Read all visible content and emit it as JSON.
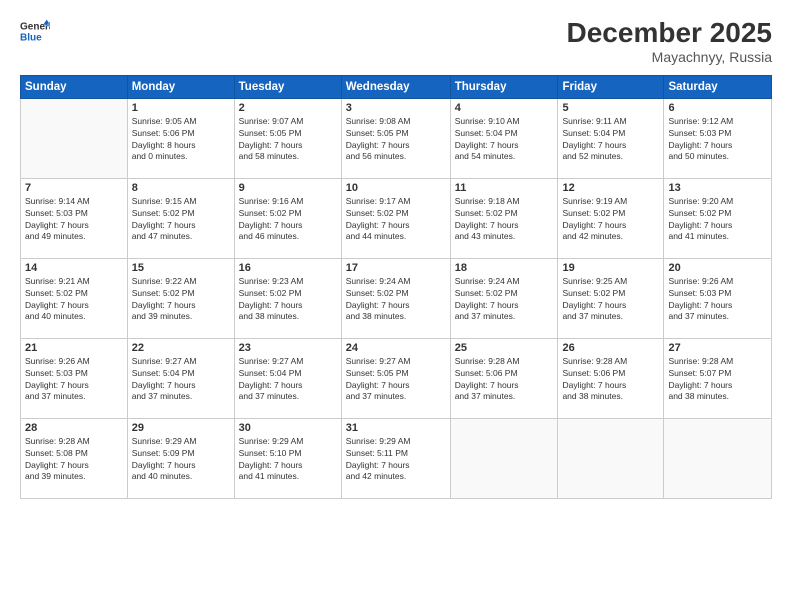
{
  "header": {
    "logo_line1": "General",
    "logo_line2": "Blue",
    "month": "December 2025",
    "location": "Mayachnyy, Russia"
  },
  "weekdays": [
    "Sunday",
    "Monday",
    "Tuesday",
    "Wednesday",
    "Thursday",
    "Friday",
    "Saturday"
  ],
  "weeks": [
    [
      {
        "day": "",
        "info": ""
      },
      {
        "day": "1",
        "info": "Sunrise: 9:05 AM\nSunset: 5:06 PM\nDaylight: 8 hours\nand 0 minutes."
      },
      {
        "day": "2",
        "info": "Sunrise: 9:07 AM\nSunset: 5:05 PM\nDaylight: 7 hours\nand 58 minutes."
      },
      {
        "day": "3",
        "info": "Sunrise: 9:08 AM\nSunset: 5:05 PM\nDaylight: 7 hours\nand 56 minutes."
      },
      {
        "day": "4",
        "info": "Sunrise: 9:10 AM\nSunset: 5:04 PM\nDaylight: 7 hours\nand 54 minutes."
      },
      {
        "day": "5",
        "info": "Sunrise: 9:11 AM\nSunset: 5:04 PM\nDaylight: 7 hours\nand 52 minutes."
      },
      {
        "day": "6",
        "info": "Sunrise: 9:12 AM\nSunset: 5:03 PM\nDaylight: 7 hours\nand 50 minutes."
      }
    ],
    [
      {
        "day": "7",
        "info": "Sunrise: 9:14 AM\nSunset: 5:03 PM\nDaylight: 7 hours\nand 49 minutes."
      },
      {
        "day": "8",
        "info": "Sunrise: 9:15 AM\nSunset: 5:02 PM\nDaylight: 7 hours\nand 47 minutes."
      },
      {
        "day": "9",
        "info": "Sunrise: 9:16 AM\nSunset: 5:02 PM\nDaylight: 7 hours\nand 46 minutes."
      },
      {
        "day": "10",
        "info": "Sunrise: 9:17 AM\nSunset: 5:02 PM\nDaylight: 7 hours\nand 44 minutes."
      },
      {
        "day": "11",
        "info": "Sunrise: 9:18 AM\nSunset: 5:02 PM\nDaylight: 7 hours\nand 43 minutes."
      },
      {
        "day": "12",
        "info": "Sunrise: 9:19 AM\nSunset: 5:02 PM\nDaylight: 7 hours\nand 42 minutes."
      },
      {
        "day": "13",
        "info": "Sunrise: 9:20 AM\nSunset: 5:02 PM\nDaylight: 7 hours\nand 41 minutes."
      }
    ],
    [
      {
        "day": "14",
        "info": "Sunrise: 9:21 AM\nSunset: 5:02 PM\nDaylight: 7 hours\nand 40 minutes."
      },
      {
        "day": "15",
        "info": "Sunrise: 9:22 AM\nSunset: 5:02 PM\nDaylight: 7 hours\nand 39 minutes."
      },
      {
        "day": "16",
        "info": "Sunrise: 9:23 AM\nSunset: 5:02 PM\nDaylight: 7 hours\nand 38 minutes."
      },
      {
        "day": "17",
        "info": "Sunrise: 9:24 AM\nSunset: 5:02 PM\nDaylight: 7 hours\nand 38 minutes."
      },
      {
        "day": "18",
        "info": "Sunrise: 9:24 AM\nSunset: 5:02 PM\nDaylight: 7 hours\nand 37 minutes."
      },
      {
        "day": "19",
        "info": "Sunrise: 9:25 AM\nSunset: 5:02 PM\nDaylight: 7 hours\nand 37 minutes."
      },
      {
        "day": "20",
        "info": "Sunrise: 9:26 AM\nSunset: 5:03 PM\nDaylight: 7 hours\nand 37 minutes."
      }
    ],
    [
      {
        "day": "21",
        "info": "Sunrise: 9:26 AM\nSunset: 5:03 PM\nDaylight: 7 hours\nand 37 minutes."
      },
      {
        "day": "22",
        "info": "Sunrise: 9:27 AM\nSunset: 5:04 PM\nDaylight: 7 hours\nand 37 minutes."
      },
      {
        "day": "23",
        "info": "Sunrise: 9:27 AM\nSunset: 5:04 PM\nDaylight: 7 hours\nand 37 minutes."
      },
      {
        "day": "24",
        "info": "Sunrise: 9:27 AM\nSunset: 5:05 PM\nDaylight: 7 hours\nand 37 minutes."
      },
      {
        "day": "25",
        "info": "Sunrise: 9:28 AM\nSunset: 5:06 PM\nDaylight: 7 hours\nand 37 minutes."
      },
      {
        "day": "26",
        "info": "Sunrise: 9:28 AM\nSunset: 5:06 PM\nDaylight: 7 hours\nand 38 minutes."
      },
      {
        "day": "27",
        "info": "Sunrise: 9:28 AM\nSunset: 5:07 PM\nDaylight: 7 hours\nand 38 minutes."
      }
    ],
    [
      {
        "day": "28",
        "info": "Sunrise: 9:28 AM\nSunset: 5:08 PM\nDaylight: 7 hours\nand 39 minutes."
      },
      {
        "day": "29",
        "info": "Sunrise: 9:29 AM\nSunset: 5:09 PM\nDaylight: 7 hours\nand 40 minutes."
      },
      {
        "day": "30",
        "info": "Sunrise: 9:29 AM\nSunset: 5:10 PM\nDaylight: 7 hours\nand 41 minutes."
      },
      {
        "day": "31",
        "info": "Sunrise: 9:29 AM\nSunset: 5:11 PM\nDaylight: 7 hours\nand 42 minutes."
      },
      {
        "day": "",
        "info": ""
      },
      {
        "day": "",
        "info": ""
      },
      {
        "day": "",
        "info": ""
      }
    ]
  ]
}
